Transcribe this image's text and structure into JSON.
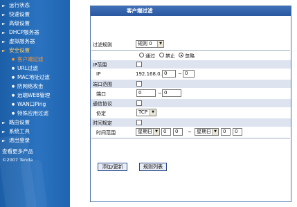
{
  "sidebar": {
    "items": [
      {
        "label": "运行状态"
      },
      {
        "label": "快速设置"
      },
      {
        "label": "高级设置"
      },
      {
        "label": "DHCP服务器"
      },
      {
        "label": "虚拟服务器"
      },
      {
        "label": "安全设置"
      }
    ],
    "sub_items": [
      {
        "label": "客户端过滤"
      },
      {
        "label": "URL过滤"
      },
      {
        "label": "MAC地址过滤"
      },
      {
        "label": "防网络攻击"
      },
      {
        "label": "远端WEB管理"
      },
      {
        "label": "WAN口Ping"
      },
      {
        "label": "特殊应用过滤"
      }
    ],
    "items2": [
      {
        "label": "路由设置"
      },
      {
        "label": "系统工具"
      },
      {
        "label": "退出登录"
      }
    ],
    "more_products": "查看更多产品",
    "copyright": "©2007 Tenda"
  },
  "panel": {
    "title": "客户端过滤",
    "filter_rule_label": "过滤规则",
    "filter_rule_value": "规则 0",
    "radio_pass": "通过",
    "radio_block": "禁止",
    "radio_ignore": "忽略",
    "ip_range_label": "IP范围",
    "ip_label": "IP",
    "ip_prefix": "192.168.0.",
    "ip_from": "0",
    "ip_to": "0",
    "port_range_label": "端口范围",
    "port_label": "端口",
    "port_from": "0",
    "port_to": "0",
    "protocol_label": "通信协议",
    "agreement_label": "协定",
    "protocol_value": "TCP",
    "time_label": "时间规定",
    "time_range_label": "时间范围",
    "day_from": "星期日",
    "hour_from": "0",
    "min_from": "0",
    "day_to": "星期日",
    "hour_to": "0",
    "min_to": "0",
    "tilde": "~",
    "add_button": "添加/更新",
    "list_button": "规则列表"
  }
}
